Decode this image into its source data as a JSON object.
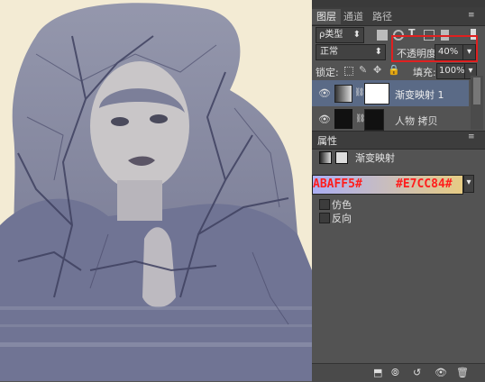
{
  "layers_panel": {
    "tabs": [
      "图层",
      "通道",
      "路径"
    ],
    "filter_type": "ρ类型",
    "blend_mode": "正常",
    "opacity_label": "不透明度:",
    "opacity_value": "40%",
    "lock_label": "锁定:",
    "fill_label": "填充:",
    "fill_value": "100%",
    "layers": [
      {
        "name": "渐变映射 1"
      },
      {
        "name": "人物 拷贝"
      }
    ]
  },
  "properties_panel": {
    "tab": "属性",
    "adjustment_title": "渐变映射",
    "gradient": {
      "start_label": "ABAFF5#",
      "end_label": "#E7CC84#",
      "start_color": "#ABAFF5",
      "end_color": "#E7CC84"
    },
    "dither_label": "仿色",
    "reverse_label": "反向"
  },
  "colors": {
    "canvas_bg": "#f3ebd4",
    "figure": "#6f7394",
    "selected_layer": "#5a6a86",
    "highlight_box": "#e02020"
  }
}
